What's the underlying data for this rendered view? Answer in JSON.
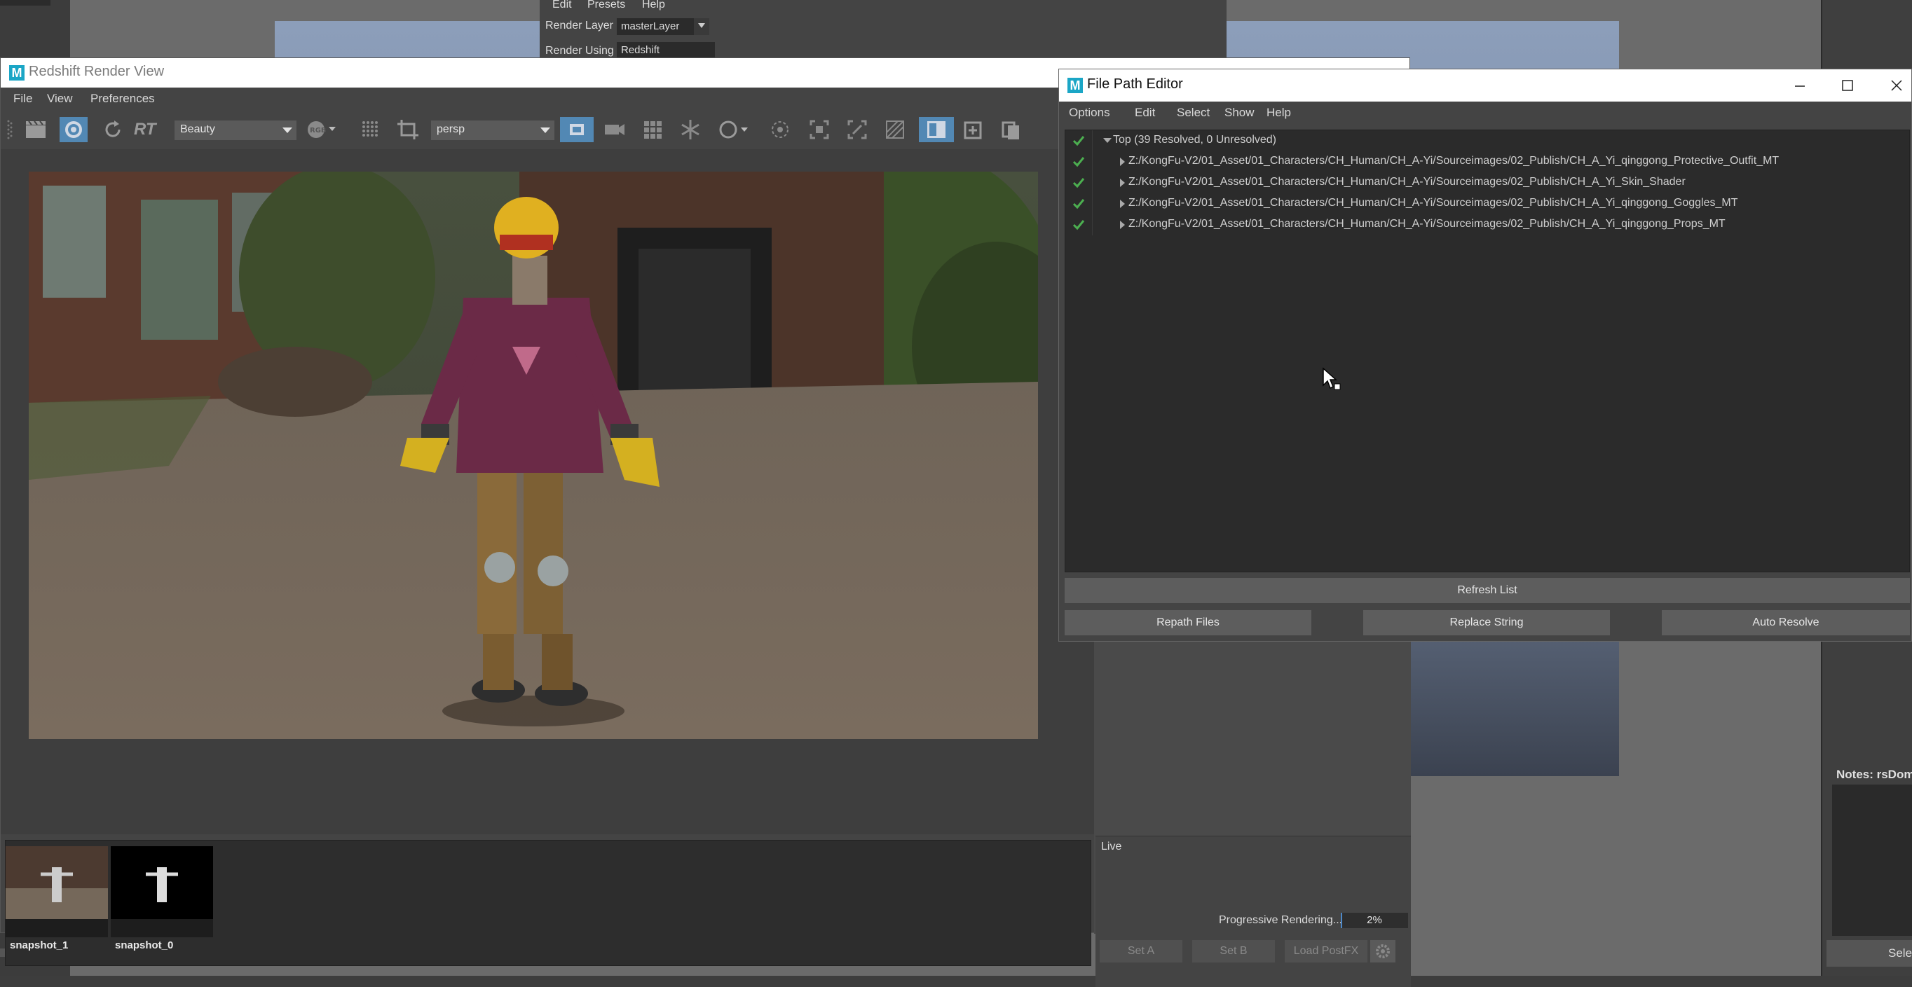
{
  "render_settings": {
    "menus": [
      "Edit",
      "Presets",
      "Help"
    ],
    "render_layer_label": "Render Layer",
    "render_layer_value": "masterLayer",
    "render_using_label": "Render Using",
    "render_using_value": "Redshift"
  },
  "render_view": {
    "title": "Redshift Render View",
    "menus": [
      "File",
      "View",
      "Preferences"
    ],
    "toolbar": {
      "rt_label": "RT",
      "aov_value": "Beauty",
      "camera_value": "persp"
    },
    "snapshots": [
      {
        "label": "snapshot_1"
      },
      {
        "label": "snapshot_0"
      }
    ],
    "live_label": "Live",
    "buttons": {
      "set_a": "Set A",
      "set_b": "Set B",
      "load_postfx": "Load PostFX"
    },
    "progress_label": "Progressive Rendering...",
    "progress_text": "2%",
    "progress_fraction": 0.02
  },
  "file_path_editor": {
    "title": "File Path Editor",
    "menus": [
      "Options",
      "Edit",
      "Select",
      "Show",
      "Help"
    ],
    "tree": {
      "root_label": "Top (39 Resolved, 0 Unresolved)",
      "items": [
        "Z:/KongFu-V2/01_Asset/01_Characters/CH_Human/CH_A-Yi/Sourceimages/02_Publish/CH_A_Yi_qinggong_Protective_Outfit_MT",
        "Z:/KongFu-V2/01_Asset/01_Characters/CH_Human/CH_A-Yi/Sourceimages/02_Publish/CH_A_Yi_Skin_Shader",
        "Z:/KongFu-V2/01_Asset/01_Characters/CH_Human/CH_A-Yi/Sourceimages/02_Publish/CH_A_Yi_qinggong_Goggles_MT",
        "Z:/KongFu-V2/01_Asset/01_Characters/CH_Human/CH_A-Yi/Sourceimages/02_Publish/CH_A_Yi_qinggong_Props_MT"
      ]
    },
    "buttons": {
      "refresh": "Refresh List",
      "repath": "Repath Files",
      "replace": "Replace String",
      "auto_resolve": "Auto Resolve"
    }
  },
  "background": {
    "viewport_camera": "persp",
    "notes_label": "Notes: rsDom",
    "select_button": "Sele"
  },
  "colors": {
    "accent_blue": "#5288b4",
    "check_green": "#4caf50",
    "maya_icon": "#1ba6c6"
  }
}
